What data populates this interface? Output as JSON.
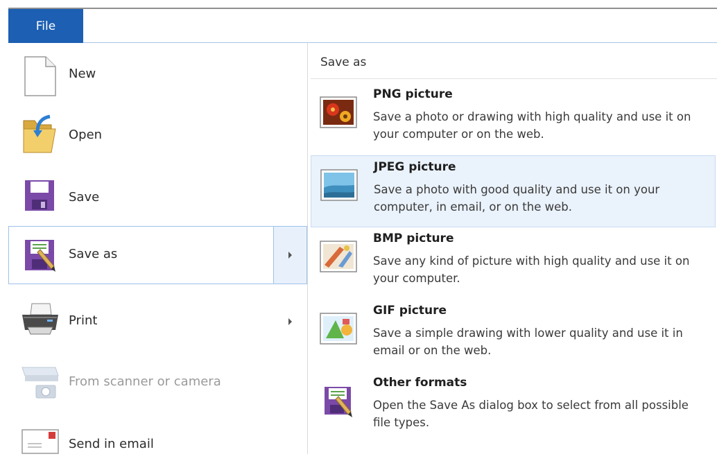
{
  "ribbon": {
    "file_tab": "File"
  },
  "left_menu": {
    "items": [
      {
        "label": "New",
        "icon": "new-document-icon"
      },
      {
        "label": "Open",
        "icon": "open-folder-icon"
      },
      {
        "label": "Save",
        "icon": "save-floppy-icon"
      },
      {
        "label": "Save as",
        "icon": "save-as-icon",
        "selected": true,
        "has_submenu": true
      },
      {
        "label": "Print",
        "icon": "printer-icon",
        "has_submenu": true
      },
      {
        "label": "From scanner or camera",
        "icon": "scanner-camera-icon",
        "disabled": true
      },
      {
        "label": "Send in email",
        "icon": "email-icon"
      }
    ]
  },
  "save_as_panel": {
    "title": "Save as",
    "formats": [
      {
        "name": "PNG picture",
        "description": "Save a photo or drawing with high quality and use it on your computer or on the web.",
        "icon": "png-picture-icon"
      },
      {
        "name": "JPEG picture",
        "description": "Save a photo with good quality and use it on your computer, in email, or on the web.",
        "icon": "jpeg-picture-icon",
        "hovered": true
      },
      {
        "name": "BMP picture",
        "description": "Save any kind of picture with high quality and use it on your computer.",
        "icon": "bmp-picture-icon"
      },
      {
        "name": "GIF picture",
        "description": "Save a simple drawing with lower quality and use it in email or on the web.",
        "icon": "gif-picture-icon"
      },
      {
        "name": "Other formats",
        "description": "Open the Save As dialog box to select from all possible file types.",
        "icon": "other-formats-icon"
      }
    ]
  },
  "colors": {
    "file_tab": "#1c5fb3",
    "selection_border": "#9cc0ea",
    "hover_bg": "#eaf2fb",
    "disabled_text": "#9a9a9a"
  }
}
